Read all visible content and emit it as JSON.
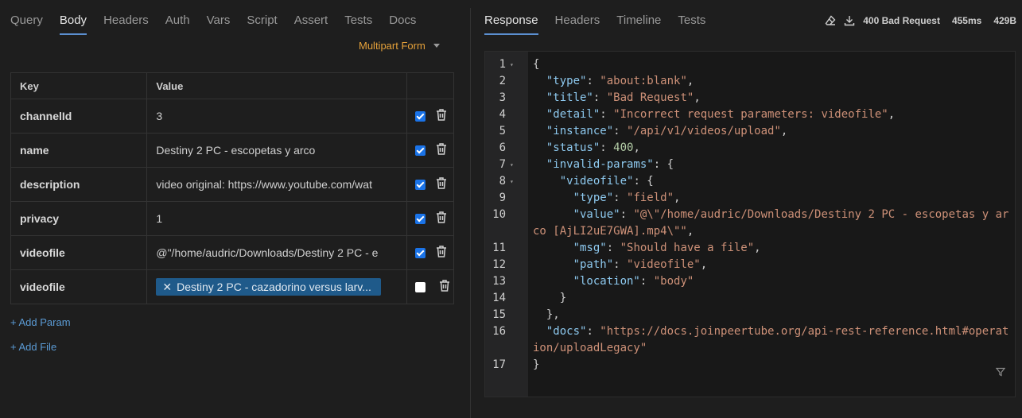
{
  "request": {
    "tabs": [
      "Query",
      "Body",
      "Headers",
      "Auth",
      "Vars",
      "Script",
      "Assert",
      "Tests",
      "Docs"
    ],
    "active_tab": "Body",
    "body_mode": "Multipart Form",
    "table_headers": {
      "key": "Key",
      "value": "Value"
    },
    "params": [
      {
        "key": "channelId",
        "value": "3",
        "enabled": true
      },
      {
        "key": "name",
        "value": "Destiny 2 PC - escopetas y arco",
        "enabled": true
      },
      {
        "key": "description",
        "value": "video original: https://www.youtube.com/wat",
        "enabled": true
      },
      {
        "key": "privacy",
        "value": "1",
        "enabled": true
      },
      {
        "key": "videofile",
        "value": "@\"/home/audric/Downloads/Destiny 2 PC - e",
        "enabled": true
      }
    ],
    "file_param": {
      "key": "videofile",
      "file": "Destiny 2 PC - cazadorino versus larv...",
      "enabled": false
    },
    "add_param": "+ Add Param",
    "add_file": "+ Add File"
  },
  "response": {
    "tabs": [
      "Response",
      "Headers",
      "Timeline",
      "Tests"
    ],
    "active_tab": "Response",
    "status": "400 Bad Request",
    "time": "455ms",
    "size": "429B",
    "lines": [
      {
        "n": "1",
        "fold": true,
        "indent": "",
        "parts": [
          {
            "t": "p",
            "v": "{"
          }
        ]
      },
      {
        "n": "2",
        "indent": "  ",
        "parts": [
          {
            "t": "k",
            "v": "\"type\""
          },
          {
            "t": "p",
            "v": ": "
          },
          {
            "t": "s",
            "v": "\"about:blank\""
          },
          {
            "t": "p",
            "v": ","
          }
        ]
      },
      {
        "n": "3",
        "indent": "  ",
        "parts": [
          {
            "t": "k",
            "v": "\"title\""
          },
          {
            "t": "p",
            "v": ": "
          },
          {
            "t": "s",
            "v": "\"Bad Request\""
          },
          {
            "t": "p",
            "v": ","
          }
        ]
      },
      {
        "n": "4",
        "indent": "  ",
        "parts": [
          {
            "t": "k",
            "v": "\"detail\""
          },
          {
            "t": "p",
            "v": ": "
          },
          {
            "t": "s",
            "v": "\"Incorrect request parameters: videofile\""
          },
          {
            "t": "p",
            "v": ","
          }
        ]
      },
      {
        "n": "5",
        "indent": "  ",
        "parts": [
          {
            "t": "k",
            "v": "\"instance\""
          },
          {
            "t": "p",
            "v": ": "
          },
          {
            "t": "s",
            "v": "\"/api/v1/videos/upload\""
          },
          {
            "t": "p",
            "v": ","
          }
        ]
      },
      {
        "n": "6",
        "indent": "  ",
        "parts": [
          {
            "t": "k",
            "v": "\"status\""
          },
          {
            "t": "p",
            "v": ": "
          },
          {
            "t": "n",
            "v": "400"
          },
          {
            "t": "p",
            "v": ","
          }
        ]
      },
      {
        "n": "7",
        "fold": true,
        "indent": "  ",
        "parts": [
          {
            "t": "k",
            "v": "\"invalid-params\""
          },
          {
            "t": "p",
            "v": ": {"
          }
        ]
      },
      {
        "n": "8",
        "fold": true,
        "indent": "    ",
        "parts": [
          {
            "t": "k",
            "v": "\"videofile\""
          },
          {
            "t": "p",
            "v": ": {"
          }
        ]
      },
      {
        "n": "9",
        "indent": "      ",
        "parts": [
          {
            "t": "k",
            "v": "\"type\""
          },
          {
            "t": "p",
            "v": ": "
          },
          {
            "t": "s",
            "v": "\"field\""
          },
          {
            "t": "p",
            "v": ","
          }
        ]
      },
      {
        "n": "10",
        "wrap": true,
        "indent": "      ",
        "parts": [
          {
            "t": "k",
            "v": "\"value\""
          },
          {
            "t": "p",
            "v": ": "
          },
          {
            "t": "s",
            "v": "\"@\\\"/home/audric/Downloads/Destiny 2 PC - escopetas y arco [AjLI2uE7GWA].mp4\\\"\""
          },
          {
            "t": "p",
            "v": ","
          }
        ]
      },
      {
        "n": "11",
        "indent": "      ",
        "parts": [
          {
            "t": "k",
            "v": "\"msg\""
          },
          {
            "t": "p",
            "v": ": "
          },
          {
            "t": "s",
            "v": "\"Should have a file\""
          },
          {
            "t": "p",
            "v": ","
          }
        ]
      },
      {
        "n": "12",
        "indent": "      ",
        "parts": [
          {
            "t": "k",
            "v": "\"path\""
          },
          {
            "t": "p",
            "v": ": "
          },
          {
            "t": "s",
            "v": "\"videofile\""
          },
          {
            "t": "p",
            "v": ","
          }
        ]
      },
      {
        "n": "13",
        "indent": "      ",
        "parts": [
          {
            "t": "k",
            "v": "\"location\""
          },
          {
            "t": "p",
            "v": ": "
          },
          {
            "t": "s",
            "v": "\"body\""
          }
        ]
      },
      {
        "n": "14",
        "indent": "    ",
        "parts": [
          {
            "t": "p",
            "v": "}"
          }
        ]
      },
      {
        "n": "15",
        "indent": "  ",
        "parts": [
          {
            "t": "p",
            "v": "},"
          }
        ]
      },
      {
        "n": "16",
        "wrap": true,
        "indent": "  ",
        "parts": [
          {
            "t": "k",
            "v": "\"docs\""
          },
          {
            "t": "p",
            "v": ": "
          },
          {
            "t": "s",
            "v": "\"https://docs.joinpeertube.org/api-rest-reference.html#operation/uploadLegacy\""
          }
        ]
      },
      {
        "n": "17",
        "indent": "",
        "parts": [
          {
            "t": "p",
            "v": "}"
          }
        ]
      }
    ]
  }
}
